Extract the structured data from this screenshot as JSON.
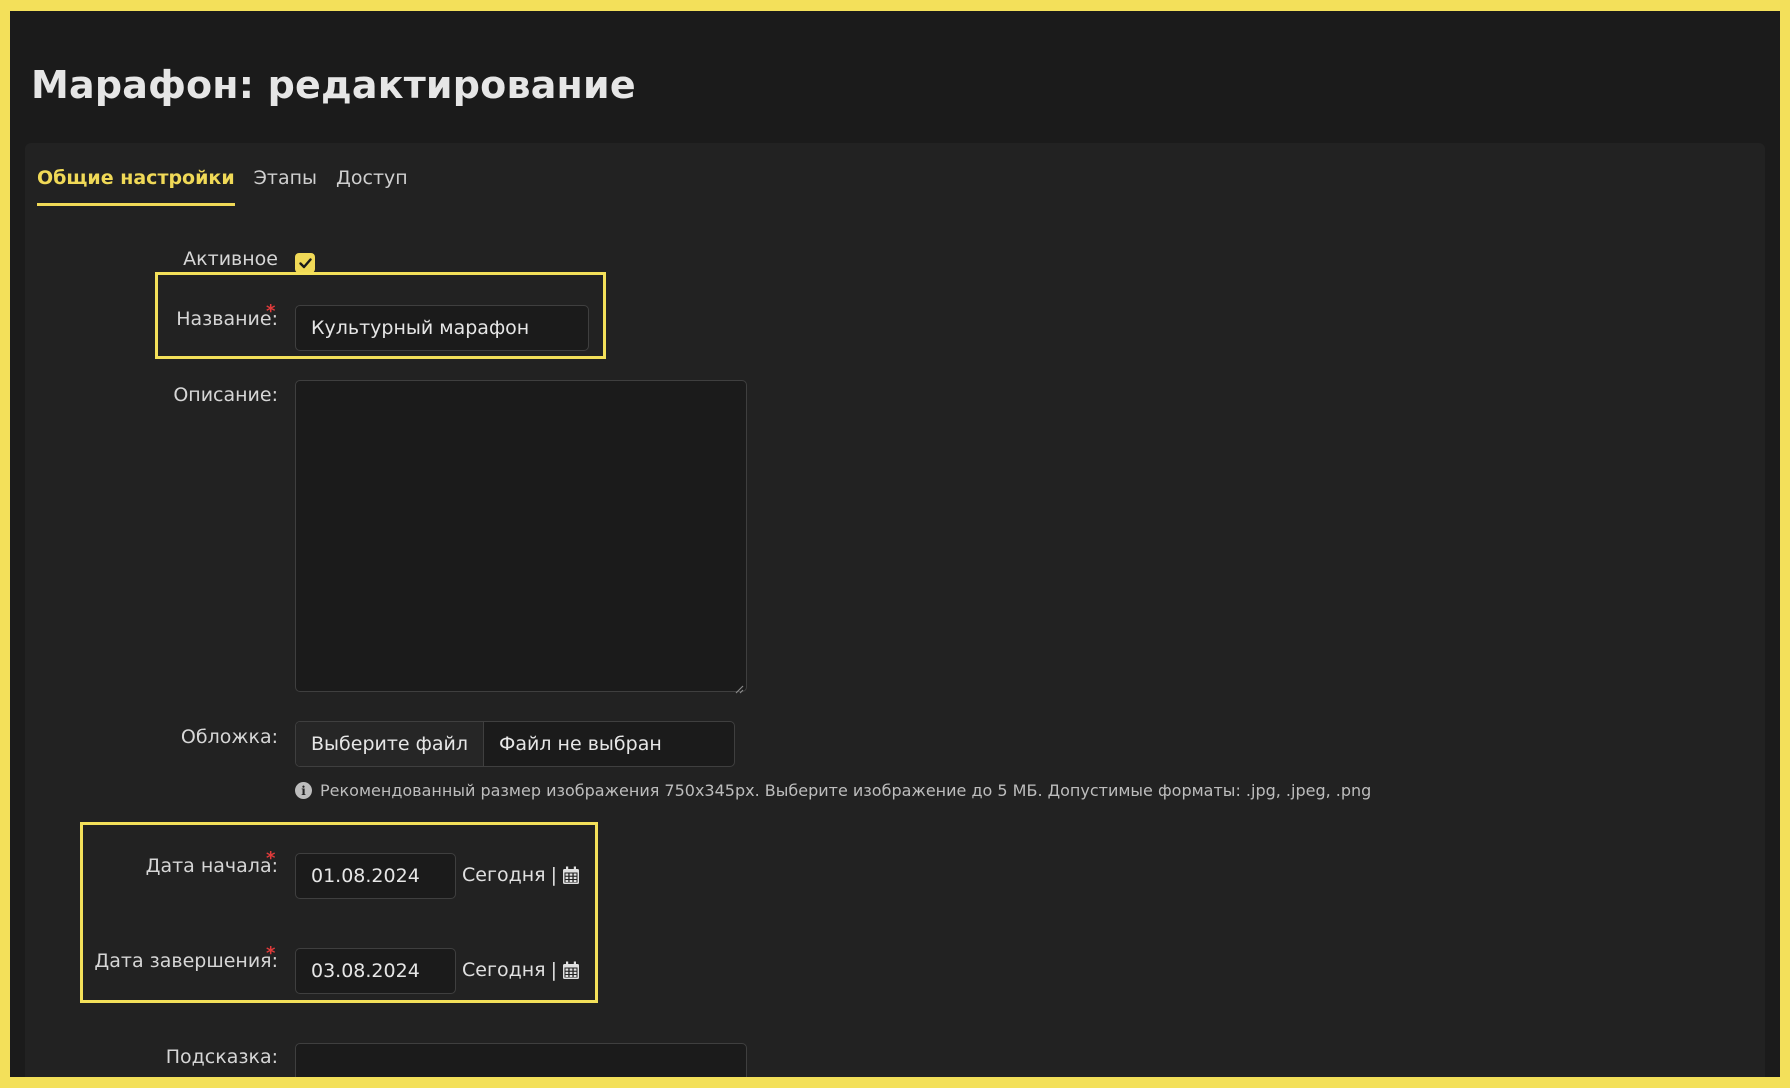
{
  "page": {
    "title": "Марафон: редактирование"
  },
  "tabs": [
    {
      "label": "Общие настройки",
      "active": true
    },
    {
      "label": "Этапы",
      "active": false
    },
    {
      "label": "Доступ",
      "active": false
    }
  ],
  "form": {
    "active": {
      "label": "Активное",
      "checked": true
    },
    "name": {
      "label": "Название:",
      "value": "Культурный марафон",
      "required_mark": "*"
    },
    "description": {
      "label": "Описание:",
      "value": ""
    },
    "cover": {
      "label": "Обложка:",
      "button_label": "Выберите файл",
      "file_status": "Файл не выбран",
      "hint": "Рекомендованный размер изображения 750x345px. Выберите изображение до 5 МБ. Допустимые форматы: .jpg, .jpeg, .png"
    },
    "start_date": {
      "label": "Дата начала:",
      "value": "01.08.2024",
      "required_mark": "*",
      "today_label": "Сегодня",
      "separator": "|"
    },
    "end_date": {
      "label": "Дата завершения:",
      "value": "03.08.2024",
      "required_mark": "*",
      "today_label": "Сегодня",
      "separator": "|"
    },
    "hint_field": {
      "label": "Подсказка:",
      "value": ""
    }
  },
  "colors": {
    "accent": "#f0d957",
    "highlight": "#f3e05a",
    "required": "#e03b3b",
    "background": "#1b1b1b",
    "panel": "#222222"
  },
  "icons": {
    "checkbox": "check-icon",
    "hint": "info-icon",
    "date_picker": "calendar-icon"
  }
}
